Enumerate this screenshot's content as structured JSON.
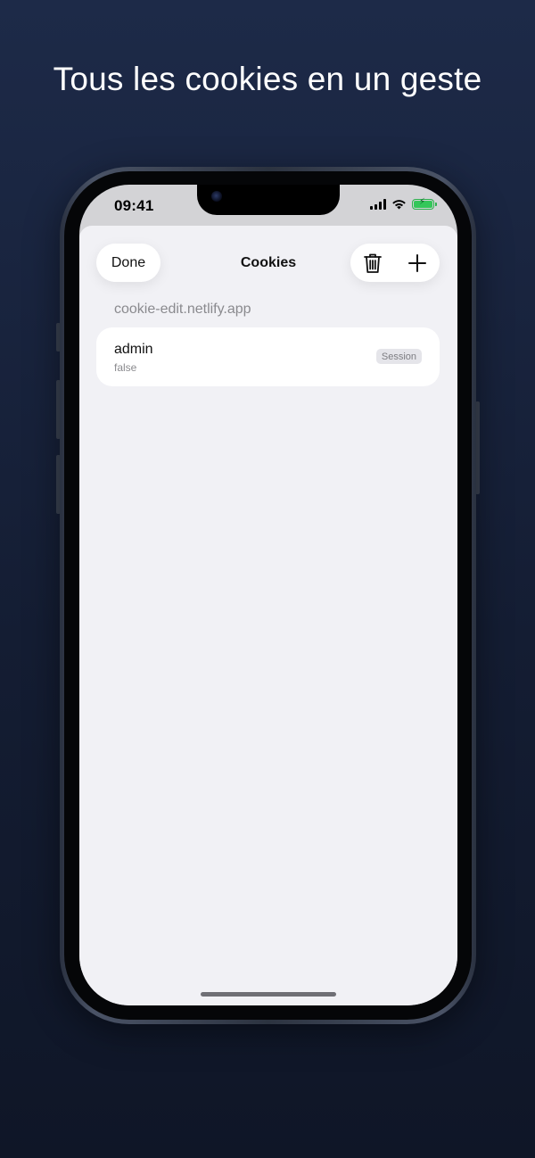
{
  "headline": "Tous les cookies en un geste",
  "status_bar": {
    "time": "09:41",
    "icons": [
      "cellular-signal-icon",
      "wifi-icon",
      "battery-charging-icon"
    ],
    "battery_color": "#34c759"
  },
  "sheet": {
    "done_label": "Done",
    "title": "Cookies",
    "actions": [
      "trash-icon",
      "plus-icon"
    ]
  },
  "domain": "cookie-edit.netlify.app",
  "cookies": [
    {
      "name": "admin",
      "value": "false",
      "badge": "Session"
    }
  ],
  "colors": {
    "background_top": "#1d2a48",
    "background_bottom": "#0f1627",
    "sheet_background": "#f1f1f5",
    "secondary_text": "#8a8a8e"
  }
}
